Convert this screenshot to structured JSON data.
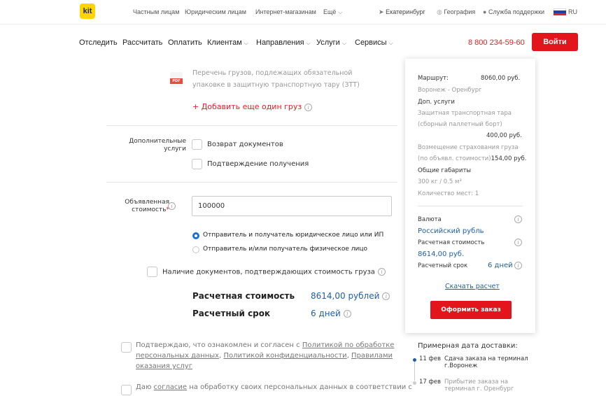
{
  "topbar": {
    "logo": "kit",
    "links": [
      "Частным лицам",
      "Юридическим лицам",
      "Интернет-магазинам",
      "Ещё"
    ],
    "city": "Екатеринбург",
    "geography": "География",
    "support": "Служба поддержки",
    "lang": "RU"
  },
  "nav": {
    "items": [
      "Отследить",
      "Рассчитать",
      "Оплатить",
      "Клиентам",
      "Направления",
      "Услуги",
      "Сервисы"
    ],
    "phone": "8 800 234-59-60",
    "login": "Войти"
  },
  "form": {
    "pdf_label": "PDF",
    "pdf_text_line1": "Перечень грузов, подлежащих обязательной",
    "pdf_text_line2": "упаковке в защитную транспортную тару (ЗТТ)",
    "add_cargo": "+ Добавить еще один груз",
    "extra_services_label_line1": "Дополнительные",
    "extra_services_label_line2": "услуги",
    "return_docs": "Возврат документов",
    "confirm_receipt": "Подтверждение получения",
    "declared_value_label_line1": "Объявленная",
    "declared_value_label_line2": "стоимость",
    "required_mark": "*",
    "declared_value": "100000",
    "radio_legal": "Отправитель и получатель юридическое лицо или ИП",
    "radio_individual": "Отправитель и/или получатель физическое лицо",
    "docs_available": "Наличие документов, подтверждающих стоимость груза",
    "calc_cost_label": "Расчетная стоимость",
    "calc_cost_value": "8614,00 рублей",
    "calc_term_label": "Расчетный срок",
    "calc_term_value": "6 дней",
    "consent1_prefix": "Подтверждаю, что ознакомлен и согласен с ",
    "consent1_link1a": "Политикой по обработке",
    "consent1_link1b": "персональных данных",
    "consent1_sep1": ", ",
    "consent1_link2": "Политикой конфиденциальности",
    "consent1_sep2": ", ",
    "consent1_link3a": "Правилами",
    "consent1_link3b": "оказания услуг",
    "consent2_prefix": "Даю ",
    "consent2_link": "согласие",
    "consent2_suffix": " на обработку своих персональных данных в соответствии с"
  },
  "panel": {
    "route_label": "Маршрут:",
    "route_price": "8060,00 руб.",
    "route": "Воронеж - Оренбург",
    "extra_label": "Доп. услуги",
    "pack_line1": "Защитная транспортная тара",
    "pack_line2": "(сборный паллетный борт)",
    "pack_price": "400,00 руб.",
    "insurance_line1": "Возмещение страхования груза",
    "insurance_line2": "(по объявл. стоимости)",
    "insurance_price": "154,00 руб.",
    "dims_label": "Общие габариты",
    "dims_value": "300 кг / 0.5 м³",
    "places": "Количество мест: 1",
    "currency_label": "Валюта",
    "currency_value": "Российский рубль",
    "cost_label": "Расчетная стоимость",
    "cost_value": "8614,00 руб.",
    "term_label": "Расчетный срок",
    "term_value": "6 дней",
    "download": "Скачать расчет",
    "order": "Оформить заказ"
  },
  "delivery": {
    "title": "Примерная дата доставки:",
    "steps": [
      {
        "date": "11 фев",
        "line1": "Сдача заказа на терминал",
        "line2": "г.Воронеж"
      },
      {
        "date": "17 фев",
        "line1": "Прибытие заказа на",
        "line2": "терминал г. Оренбург"
      }
    ]
  },
  "colors": {
    "accent": "#e31e24",
    "link": "#1f5fa8",
    "radio": "#1f6fd1",
    "logo": "#ffd400"
  }
}
